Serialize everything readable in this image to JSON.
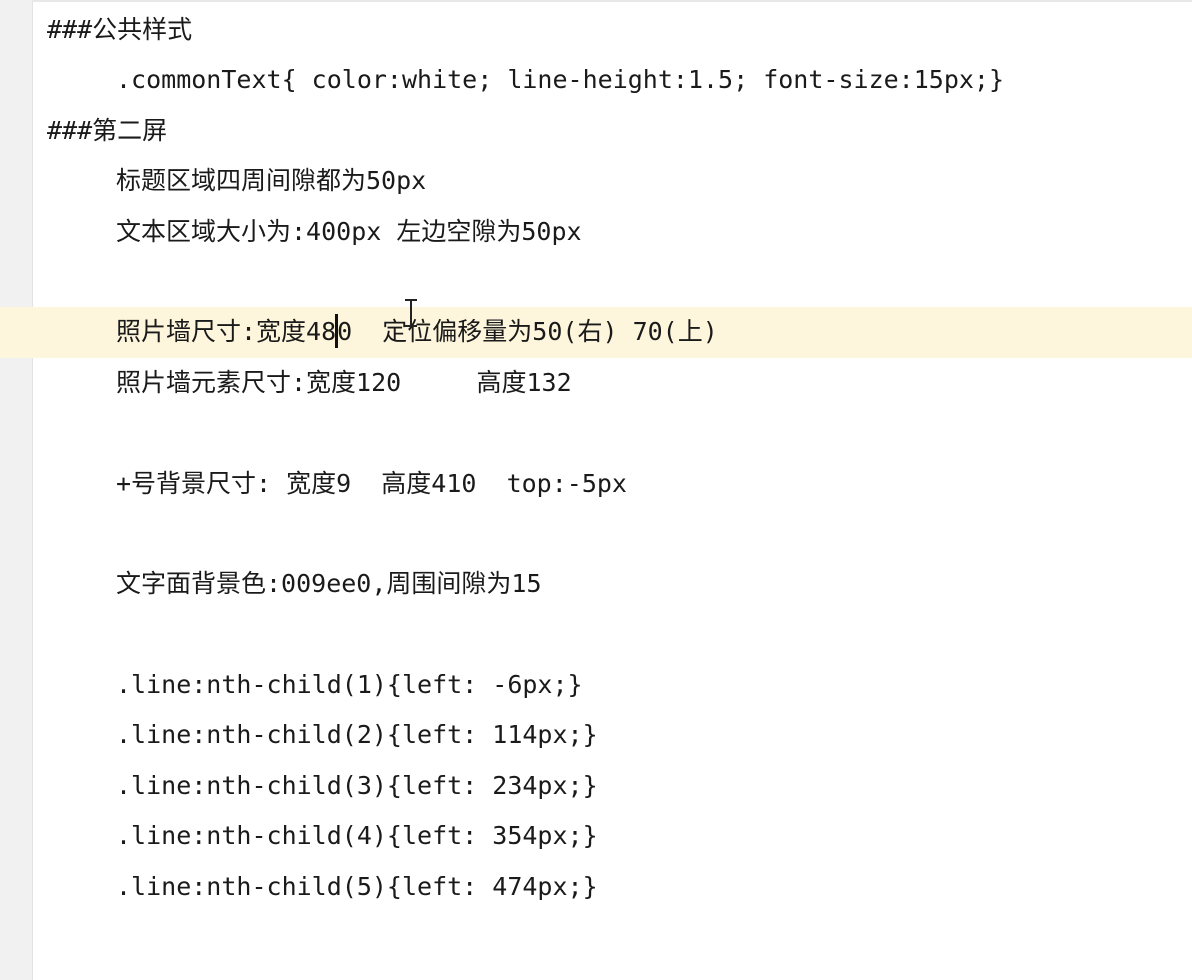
{
  "editor": {
    "lines": [
      "###公共样式",
      ".commonText{ color:white; line-height:1.5; font-size:15px;}",
      "###第二屏",
      "标题区域四周间隙都为50px",
      "文本区域大小为:400px 左边空隙为50px",
      "",
      "照片墙尺寸:宽度48",
      "照片墙元素尺寸:宽度120     高度132",
      "",
      "+号背景尺寸: 宽度9  高度410  top:-5px",
      "",
      "文字面背景色:009ee0,周围间隙为15",
      "",
      ".line:nth-child(1){left: -6px;}",
      ".line:nth-child(2){left: 114px;}",
      ".line:nth-child(3){left: 234px;}",
      ".line:nth-child(4){left: 354px;}",
      ".line:nth-child(5){left: 474px;}"
    ],
    "current_line_after_caret": "0  定位偏移量为50(右) 70(上)"
  }
}
